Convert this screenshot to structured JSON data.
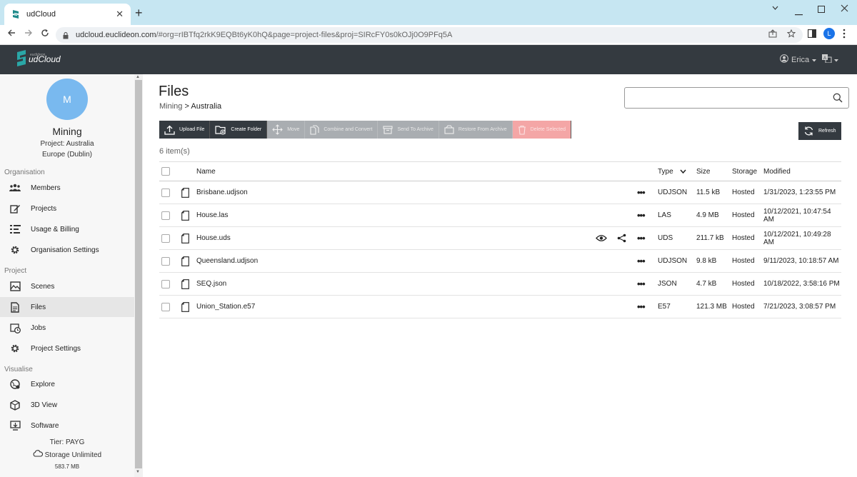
{
  "browser": {
    "tab_title": "udCloud",
    "url_host": "udcloud.euclideon.com",
    "url_path": "/#org=rIBTfq2rkK9EQBt6yK0hQ&page=project-files&proj=SIRcFY0s0kOJj0O9PFq5A",
    "profile_initial": "L",
    "new_tab_glyph": "+",
    "close_glyph": "✕"
  },
  "app": {
    "logo_small": "euclideon",
    "logo_main": "udCloud",
    "user_name": "Erica"
  },
  "sidebar": {
    "avatar_initial": "M",
    "org_name": "Mining",
    "project_line": "Project: Australia",
    "region_line": "Europe (Dublin)",
    "sections": {
      "organisation": "Organisation",
      "project": "Project",
      "visualise": "Visualise"
    },
    "org_items": [
      {
        "label": "Members",
        "icon": "members-icon"
      },
      {
        "label": "Projects",
        "icon": "projects-icon"
      },
      {
        "label": "Usage & Billing",
        "icon": "billing-icon"
      },
      {
        "label": "Organisation Settings",
        "icon": "gear-icon"
      }
    ],
    "project_items": [
      {
        "label": "Scenes",
        "icon": "scenes-icon"
      },
      {
        "label": "Files",
        "icon": "files-icon"
      },
      {
        "label": "Jobs",
        "icon": "jobs-icon"
      },
      {
        "label": "Project Settings",
        "icon": "gear-icon"
      }
    ],
    "visualise_items": [
      {
        "label": "Explore",
        "icon": "explore-icon"
      },
      {
        "label": "3D View",
        "icon": "cube-icon"
      },
      {
        "label": "Software",
        "icon": "download-icon"
      }
    ],
    "tier": "Tier: PAYG",
    "storage": "Storage Unlimited",
    "storage_used": "583.7 MB"
  },
  "main": {
    "title": "Files",
    "breadcrumb_parent": "Mining",
    "breadcrumb_sep": ">",
    "breadcrumb_current": "Australia",
    "search_placeholder": "",
    "toolbar": {
      "upload": "Upload File",
      "create_folder": "Create Folder",
      "move": "Move",
      "combine": "Combine and Convert",
      "archive": "Send To Archive",
      "restore": "Restore From Archive",
      "delete": "Delete Selected",
      "refresh": "Refresh"
    },
    "item_count": "6 item(s)",
    "columns": {
      "name": "Name",
      "type": "Type",
      "size": "Size",
      "storage": "Storage",
      "modified": "Modified"
    },
    "actions_glyph": "•••",
    "files": [
      {
        "name": "Brisbane.udjson",
        "type": "UDJSON",
        "size": "11.5 kB",
        "storage": "Hosted",
        "modified": "1/31/2023, 1:23:55 PM"
      },
      {
        "name": "House.las",
        "type": "LAS",
        "size": "4.9 MB",
        "storage": "Hosted",
        "modified": "10/12/2021, 10:47:54 AM"
      },
      {
        "name": "House.uds",
        "type": "UDS",
        "size": "211.7 kB",
        "storage": "Hosted",
        "modified": "10/12/2021, 10:49:28 AM"
      },
      {
        "name": "Queensland.udjson",
        "type": "UDJSON",
        "size": "9.8 kB",
        "storage": "Hosted",
        "modified": "9/11/2023, 10:18:57 AM"
      },
      {
        "name": "SEQ.json",
        "type": "JSON",
        "size": "4.7 kB",
        "storage": "Hosted",
        "modified": "10/18/2022, 3:58:16 PM"
      },
      {
        "name": "Union_Station.e57",
        "type": "E57",
        "size": "121.3 MB",
        "storage": "Hosted",
        "modified": "7/21/2023, 3:08:57 PM"
      }
    ]
  }
}
